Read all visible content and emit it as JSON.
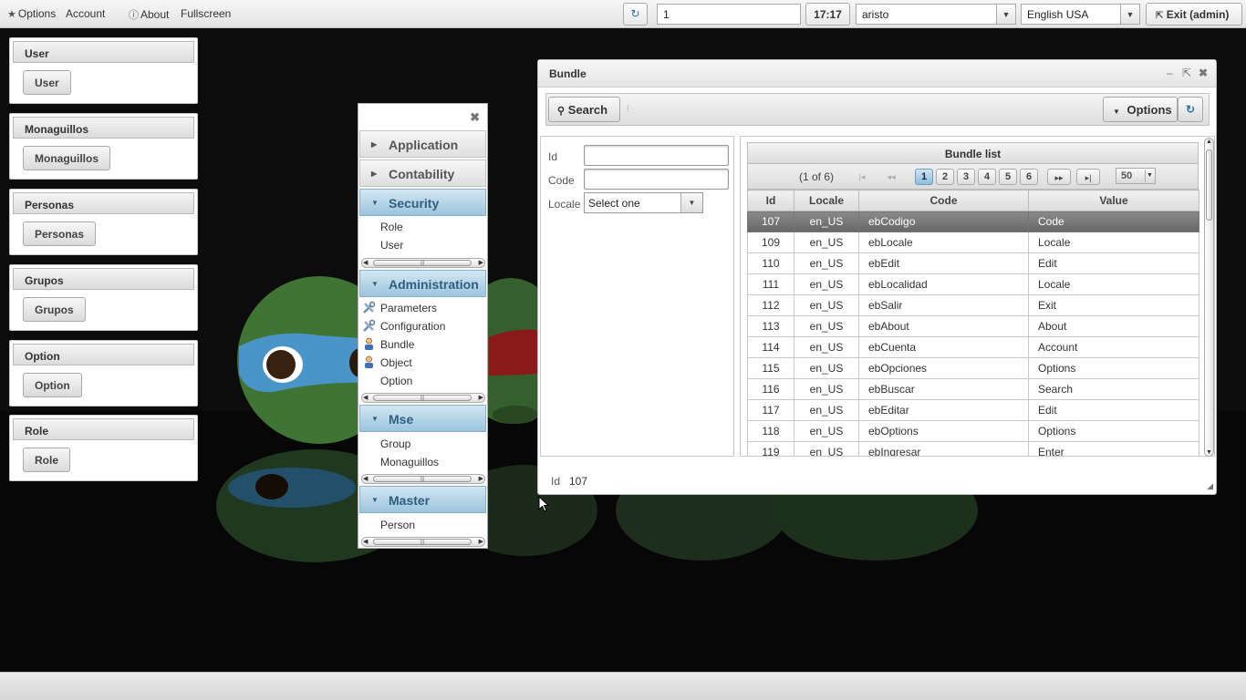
{
  "topbar": {
    "options_label": "Options",
    "account_label": "Account",
    "about_label": "About",
    "fullscreen_label": "Fullscreen",
    "session_value": "1",
    "clock": "17:17",
    "user_value": "aristo",
    "language_value": "English USA",
    "exit_label": "Exit (admin)"
  },
  "widgets": [
    {
      "title": "User",
      "button": "User"
    },
    {
      "title": "Monaguillos",
      "button": "Monaguillos"
    },
    {
      "title": "Personas",
      "button": "Personas"
    },
    {
      "title": "Grupos",
      "button": "Grupos"
    },
    {
      "title": "Option",
      "button": "Option"
    },
    {
      "title": "Role",
      "button": "Role"
    }
  ],
  "menu": {
    "sections": [
      {
        "label": "Application",
        "open": false,
        "items": []
      },
      {
        "label": "Contability",
        "open": false,
        "items": []
      },
      {
        "label": "Security",
        "open": true,
        "items": [
          {
            "label": "Role",
            "icon": ""
          },
          {
            "label": "User",
            "icon": ""
          }
        ]
      },
      {
        "label": "Administration",
        "open": true,
        "items": [
          {
            "label": "Parameters",
            "icon": "tools-icon"
          },
          {
            "label": "Configuration",
            "icon": "tools-icon"
          },
          {
            "label": "Bundle",
            "icon": "person-icon"
          },
          {
            "label": "Object",
            "icon": "person-icon"
          },
          {
            "label": "Option",
            "icon": ""
          }
        ]
      },
      {
        "label": "Mse",
        "open": true,
        "items": [
          {
            "label": "Group",
            "icon": ""
          },
          {
            "label": "Monaguillos",
            "icon": ""
          }
        ]
      },
      {
        "label": "Master",
        "open": true,
        "items": [
          {
            "label": "Person",
            "icon": ""
          }
        ]
      }
    ]
  },
  "dialog": {
    "title": "Bundle",
    "search_label": "Search",
    "options_label": "Options",
    "form": {
      "id_label": "Id",
      "code_label": "Code",
      "locale_label": "Locale",
      "locale_value": "Select one"
    },
    "list": {
      "title": "Bundle list",
      "page_report": "(1 of 6)",
      "pages": [
        "1",
        "2",
        "3",
        "4",
        "5",
        "6"
      ],
      "current_page": "1",
      "rows_per_page": "50",
      "columns": [
        "Id",
        "Locale",
        "Code",
        "Value"
      ],
      "rows": [
        [
          "107",
          "en_US",
          "ebCodigo",
          "Code"
        ],
        [
          "109",
          "en_US",
          "ebLocale",
          "Locale"
        ],
        [
          "110",
          "en_US",
          "ebEdit",
          "Edit"
        ],
        [
          "111",
          "en_US",
          "ebLocalidad",
          "Locale"
        ],
        [
          "112",
          "en_US",
          "ebSalir",
          "Exit"
        ],
        [
          "113",
          "en_US",
          "ebAbout",
          "About"
        ],
        [
          "114",
          "en_US",
          "ebCuenta",
          "Account"
        ],
        [
          "115",
          "en_US",
          "ebOpciones",
          "Options"
        ],
        [
          "116",
          "en_US",
          "ebBuscar",
          "Search"
        ],
        [
          "117",
          "en_US",
          "ebEditar",
          "Edit"
        ],
        [
          "118",
          "en_US",
          "ebOptions",
          "Options"
        ],
        [
          "119",
          "en_US",
          "ebIngresar",
          "Enter"
        ]
      ],
      "selected_row": 0
    },
    "footer": {
      "id_label": "Id",
      "id_value": "107"
    }
  },
  "colors": {
    "accent_header": "#9cc5dd",
    "selected_row": "#666666",
    "background": "#000000"
  }
}
